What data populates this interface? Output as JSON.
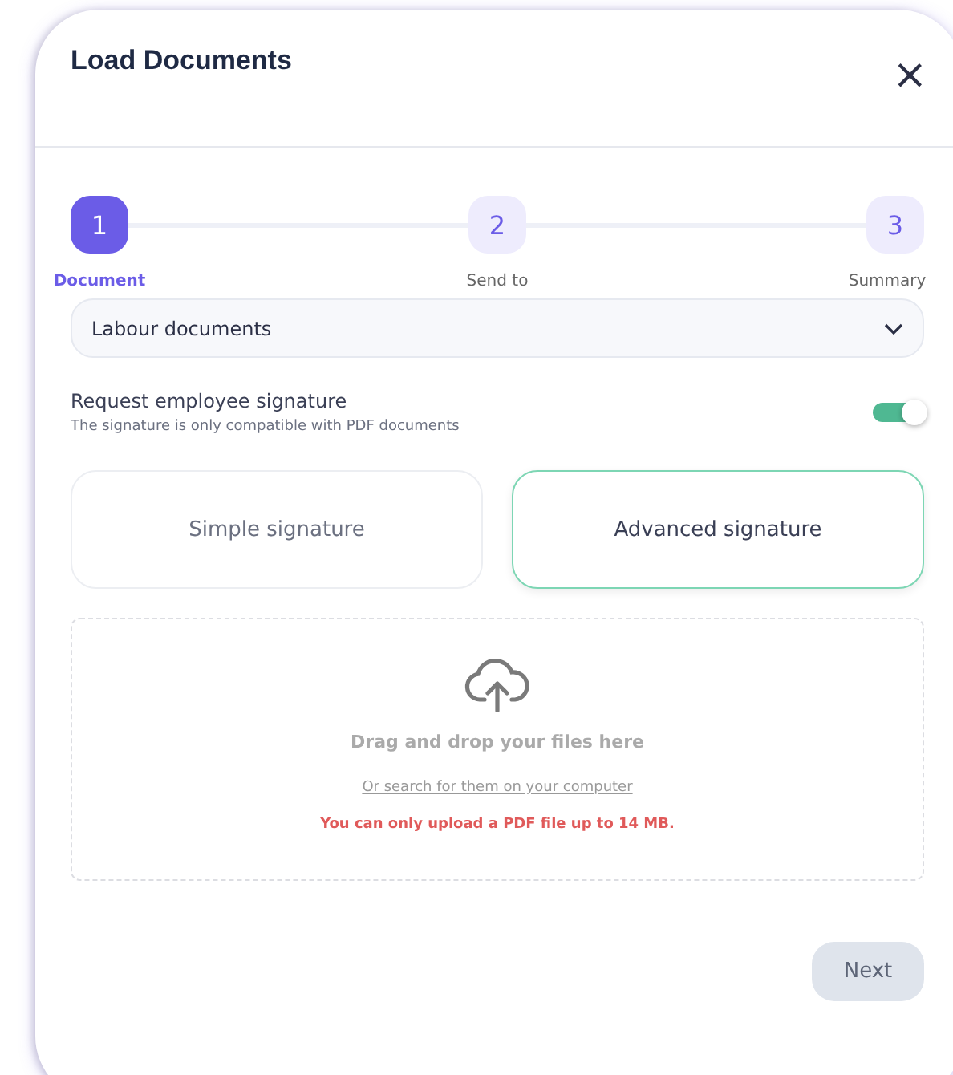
{
  "dialog": {
    "title": "Load Documents",
    "close": "×"
  },
  "steps": [
    {
      "number": "1",
      "label": "Document",
      "selected": true
    },
    {
      "number": "2",
      "label": "Send to",
      "selected": false
    },
    {
      "number": "3",
      "label": "Summary",
      "selected": false
    }
  ],
  "document_type": {
    "value": "Labour documents"
  },
  "signature_request": {
    "label": "Request employee signature",
    "hint": "The signature is only compatible with PDF documents",
    "on": true
  },
  "signature_options": [
    {
      "label": "Simple signature",
      "selected": false
    },
    {
      "label": "Advanced signature",
      "selected": true
    }
  ],
  "upload": {
    "title": "Drag and drop your files here",
    "link": "Or search for them on your computer",
    "warning": "You can only upload a PDF file up to 14 MB."
  },
  "next_button": {
    "label": "Next",
    "disabled": true
  }
}
